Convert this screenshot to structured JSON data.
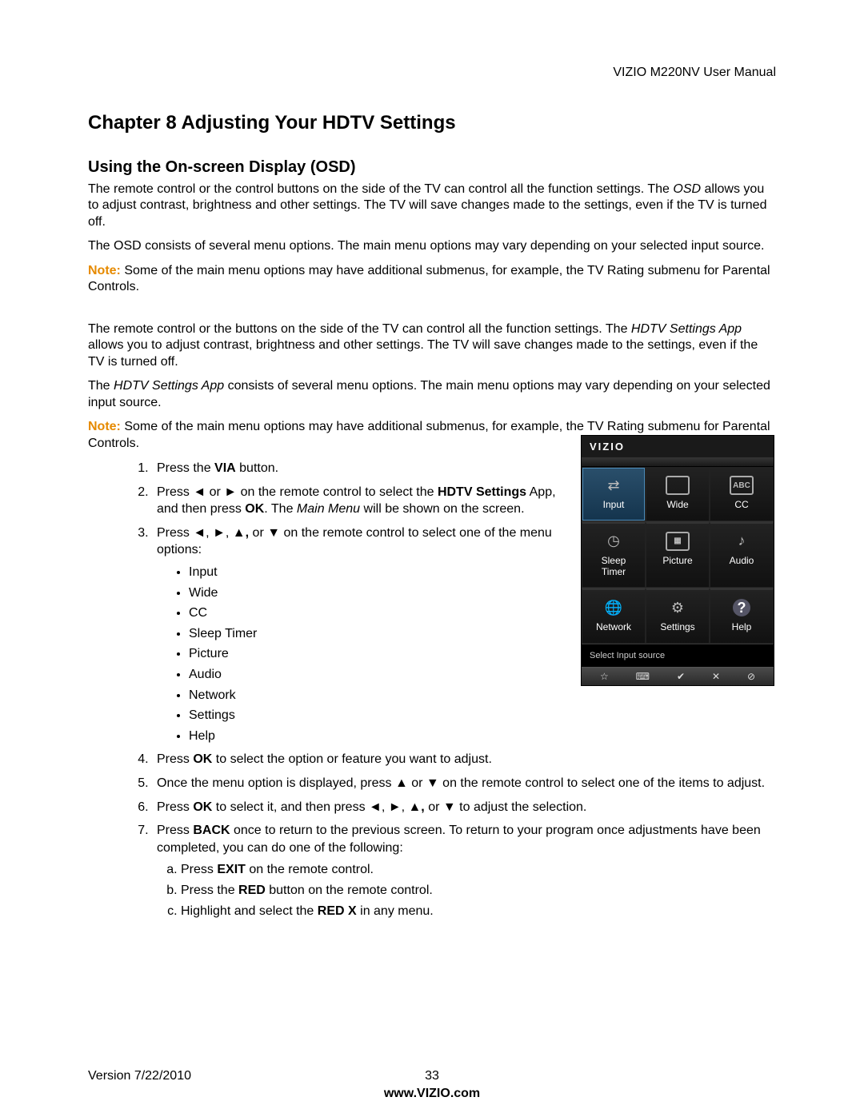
{
  "header": {
    "doc_title": "VIZIO M220NV User Manual"
  },
  "chapter": {
    "title": "Chapter 8 Adjusting Your HDTV Settings"
  },
  "section": {
    "title": "Using the On-screen Display (OSD)"
  },
  "paras": {
    "p1a": "The remote control or the control buttons on the side of the TV can control all the function settings. The ",
    "p1_osd": "OSD",
    "p1b": " allows you to adjust contrast, brightness and other settings. The TV will save changes made to the settings, even if the TV is turned off.",
    "p2": "The OSD consists of several menu options. The main menu options may vary depending on your selected input source.",
    "note_label": "Note:",
    "note1_text_a": "  Some of the main menu options may have additional submenus, for example, the TV Rating submenu for Parental Controls.",
    "p3a": "The remote control or the buttons on the side of the TV can control all the function settings. The ",
    "p3_hdtv": "HDTV Settings App",
    "p3b": " allows you to adjust contrast, brightness and other settings. The TV will save changes made to the settings, even if the TV is turned off.",
    "p4a": "The ",
    "p4_hdtv": "HDTV Settings App",
    "p4b": " consists of several menu options. The main menu options may vary depending on your selected input source.",
    "note2_text_a": "  Some of the main menu options may have additional submenus, for example, the TV Rating submenu for Parental Controls."
  },
  "steps": {
    "s1a": "Press the ",
    "s1_via": "VIA",
    "s1b": " button.",
    "s2a": "Press ◄ or ► on the remote control to select the ",
    "s2_hdtv": "HDTV Settings",
    "s2b": " App, and then press ",
    "s2_ok": "OK",
    "s2c": ". The ",
    "s2_mainmenu": "Main Menu",
    "s2d": " will be shown on the screen.",
    "s3a": "Press ◄, ►, ▲",
    "s3_comma": ",",
    "s3b": " or ▼ on the remote control to select one of the menu options:",
    "s4a": "Press ",
    "s4_ok": "OK",
    "s4b": " to select the option or feature you want to adjust.",
    "s5": "Once the menu option is displayed, press ▲ or ▼ on the remote control to select one of the items to adjust.",
    "s6a": "Press ",
    "s6_ok": "OK",
    "s6b": " to select it, and then press ◄, ►, ▲",
    "s6_comma": ",",
    "s6c": " or ▼ to adjust the selection.",
    "s7a": "Press ",
    "s7_back": "BACK",
    "s7b": " once to return to the previous screen. To return to your program once adjustments have been completed, you can do one of the following:",
    "sub_a_a": "Press ",
    "sub_a_exit": "EXIT",
    "sub_a_b": " on the remote control.",
    "sub_b_a": "Press the ",
    "sub_b_red": "RED",
    "sub_b_b": " button on the remote control.",
    "sub_c_a": "Highlight and select the ",
    "sub_c_redx": "RED X",
    "sub_c_b": " in any menu."
  },
  "menu_options": [
    "Input",
    "Wide",
    "CC",
    "Sleep Timer",
    "Picture",
    "Audio",
    "Network",
    "Settings",
    "Help"
  ],
  "tv": {
    "brand": "VIZIO",
    "grid": [
      {
        "label": "Input"
      },
      {
        "label": "Wide"
      },
      {
        "label": "CC"
      },
      {
        "label": "Sleep\nTimer"
      },
      {
        "label": "Picture"
      },
      {
        "label": "Audio"
      },
      {
        "label": "Network"
      },
      {
        "label": "Settings"
      },
      {
        "label": "Help"
      }
    ],
    "status": "Select Input source",
    "bottombar": [
      "☆",
      "⌨",
      "✔",
      "✕",
      "⊘"
    ]
  },
  "footer": {
    "version": "Version 7/22/2010",
    "page": "33",
    "url": "www.VIZIO.com"
  }
}
